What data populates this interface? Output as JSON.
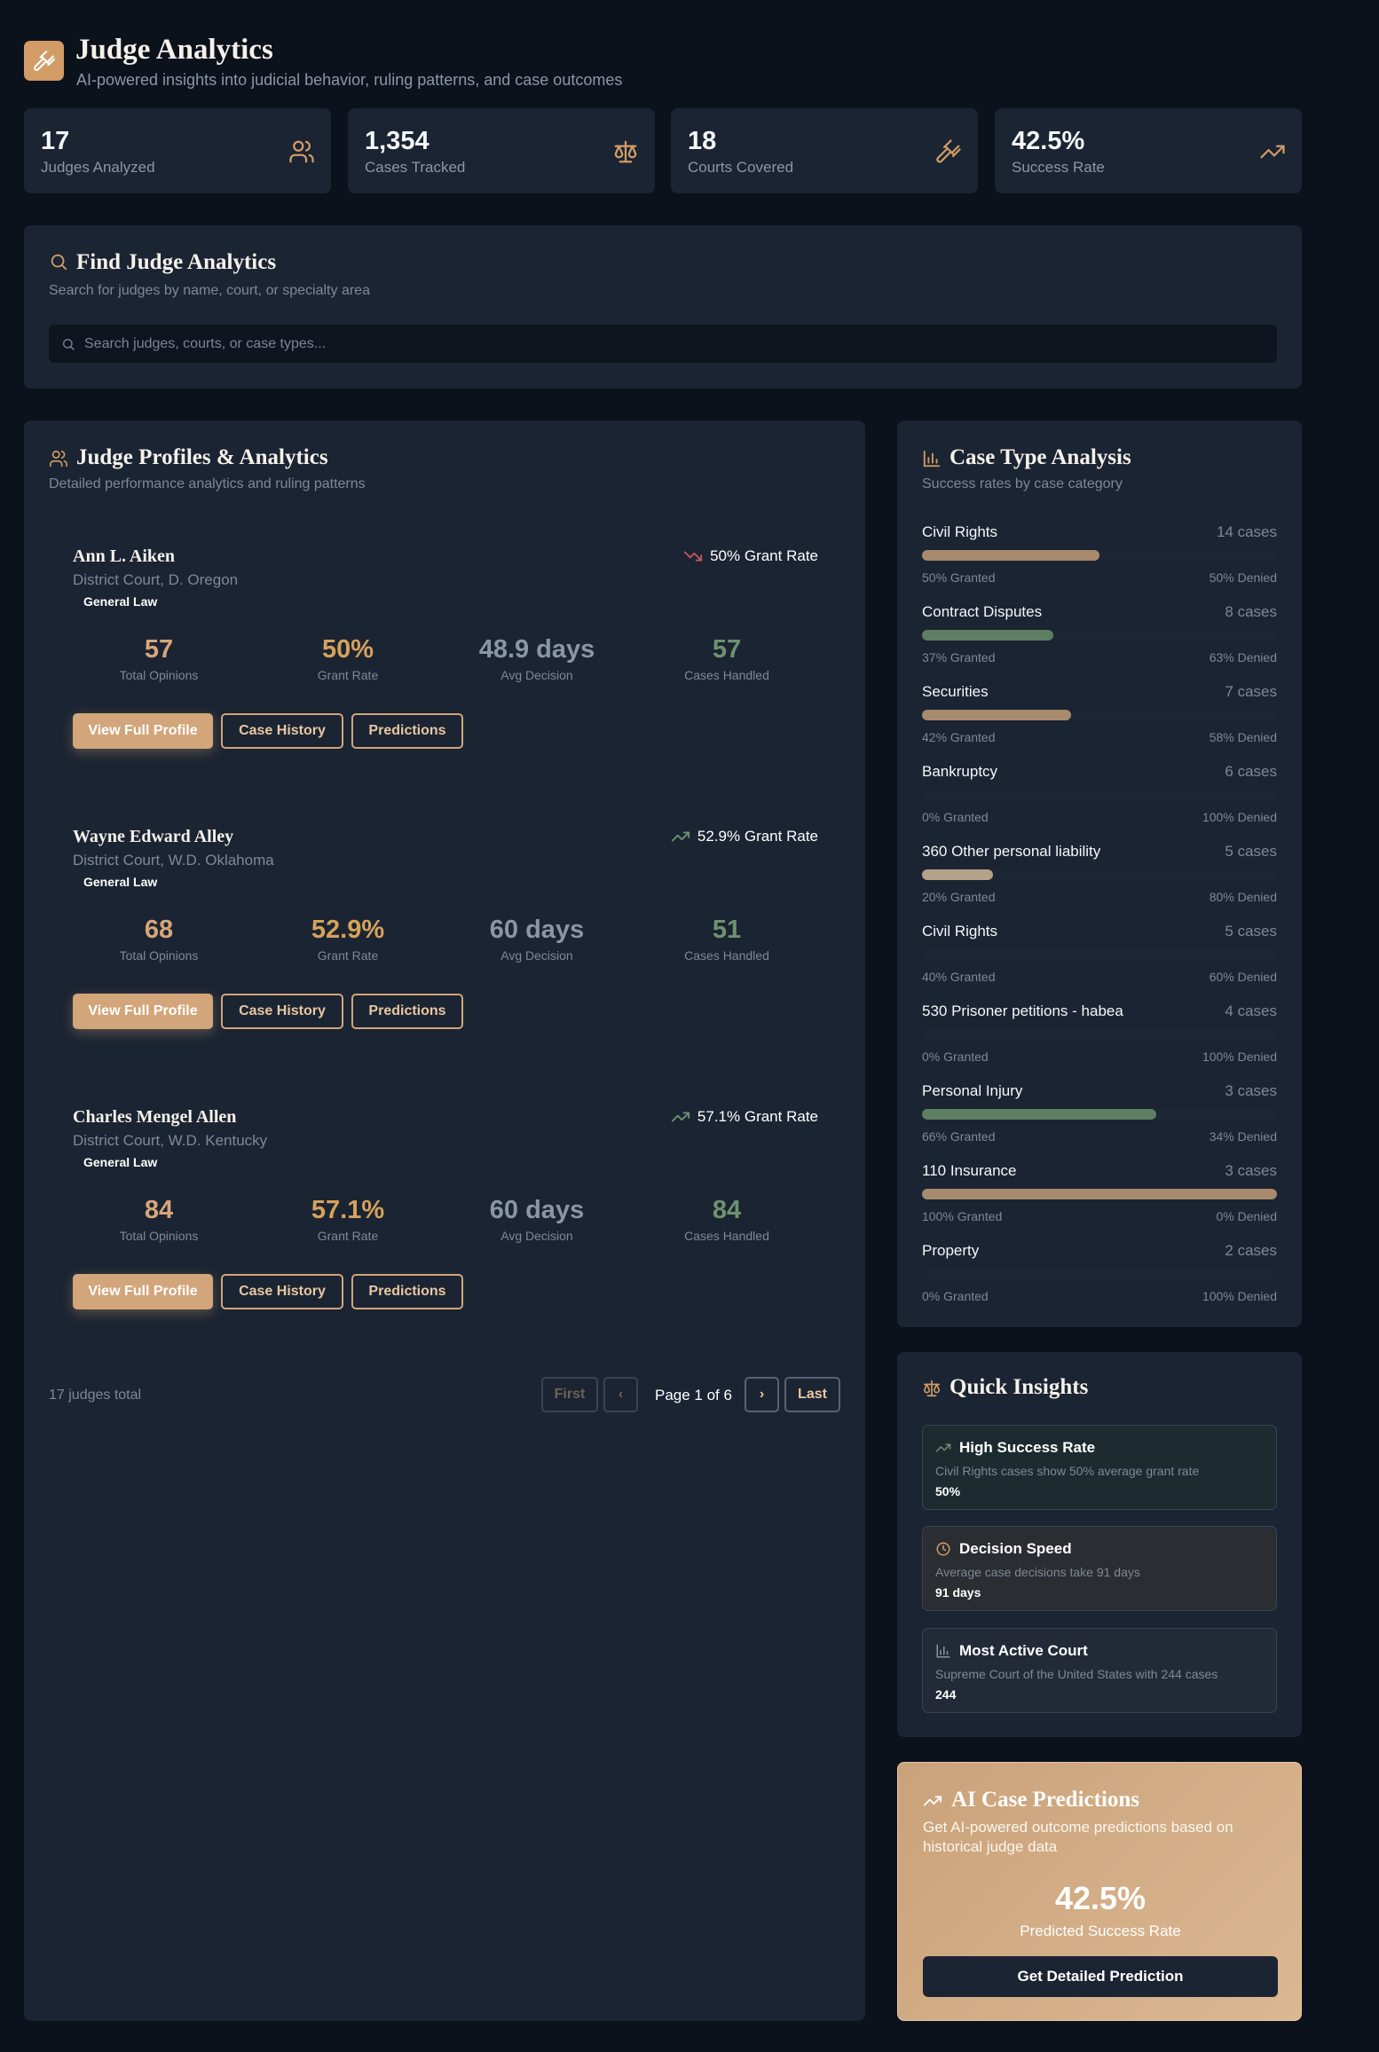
{
  "header": {
    "title": "Judge Analytics",
    "subtitle": "AI-powered insights into judicial behavior, ruling patterns, and case outcomes"
  },
  "stats": [
    {
      "value": "17",
      "label": "Judges Analyzed",
      "icon": "users-icon"
    },
    {
      "value": "1,354",
      "label": "Cases Tracked",
      "icon": "scale-icon"
    },
    {
      "value": "18",
      "label": "Courts Covered",
      "icon": "gavel-icon"
    },
    {
      "value": "42.5%",
      "label": "Success Rate",
      "icon": "trending-up-icon"
    }
  ],
  "search": {
    "title": "Find Judge Analytics",
    "subtitle": "Search for judges by name, court, or specialty area",
    "placeholder": "Search judges, courts, or case types...",
    "value": ""
  },
  "judges_panel": {
    "title": "Judge Profiles & Analytics",
    "subtitle": "Detailed performance analytics and ruling patterns",
    "judges": [
      {
        "name": "Ann L. Aiken",
        "court": "District Court, D. Oregon",
        "tag": "General Law",
        "grant_rate_label": "50% Grant Rate",
        "trend": "down",
        "metrics": [
          {
            "value": "57",
            "label": "Total Opinions"
          },
          {
            "value": "50%",
            "label": "Grant Rate"
          },
          {
            "value": "48.9 days",
            "label": "Avg Decision"
          },
          {
            "value": "57",
            "label": "Cases Handled"
          }
        ]
      },
      {
        "name": "Wayne Edward Alley",
        "court": "District Court, W.D. Oklahoma",
        "tag": "General Law",
        "grant_rate_label": "52.9% Grant Rate",
        "trend": "up",
        "metrics": [
          {
            "value": "68",
            "label": "Total Opinions"
          },
          {
            "value": "52.9%",
            "label": "Grant Rate"
          },
          {
            "value": "60 days",
            "label": "Avg Decision"
          },
          {
            "value": "51",
            "label": "Cases Handled"
          }
        ]
      },
      {
        "name": "Charles Mengel Allen",
        "court": "District Court, W.D. Kentucky",
        "tag": "General Law",
        "grant_rate_label": "57.1% Grant Rate",
        "trend": "up",
        "metrics": [
          {
            "value": "84",
            "label": "Total Opinions"
          },
          {
            "value": "57.1%",
            "label": "Grant Rate"
          },
          {
            "value": "60 days",
            "label": "Avg Decision"
          },
          {
            "value": "84",
            "label": "Cases Handled"
          }
        ]
      }
    ],
    "buttons": {
      "profile": "View Full Profile",
      "history": "Case History",
      "predictions": "Predictions"
    },
    "pagination": {
      "total": "17 judges total",
      "first": "First",
      "prev": "‹",
      "info": "Page 1 of 6",
      "next": "›",
      "last": "Last"
    }
  },
  "case_types": {
    "title": "Case Type Analysis",
    "subtitle": "Success rates by case category",
    "items": [
      {
        "name": "Civil Rights",
        "count": "14 cases",
        "granted": "50% Granted",
        "denied": "50% Denied",
        "pct": 50,
        "color": "#a88a6c"
      },
      {
        "name": "Contract Disputes",
        "count": "8 cases",
        "granted": "37% Granted",
        "denied": "63% Denied",
        "pct": 37,
        "color": "#5e7e62"
      },
      {
        "name": "Securities",
        "count": "7 cases",
        "granted": "42% Granted",
        "denied": "58% Denied",
        "pct": 42,
        "color": "#a88a6c"
      },
      {
        "name": "Bankruptcy",
        "count": "6 cases",
        "granted": "0% Granted",
        "denied": "100% Denied",
        "pct": 0,
        "color": "#a88a6c"
      },
      {
        "name": "360 Other personal liability",
        "count": "5 cases",
        "granted": "20% Granted",
        "denied": "80% Denied",
        "pct": 20,
        "color": "#b6a189"
      },
      {
        "name": "Civil Rights",
        "count": "5 cases",
        "granted": "40% Granted",
        "denied": "60% Denied",
        "pct": 0,
        "color": "#a88a6c"
      },
      {
        "name": "530 Prisoner petitions - habea",
        "count": "4 cases",
        "granted": "0% Granted",
        "denied": "100% Denied",
        "pct": 0,
        "color": "#a88a6c"
      },
      {
        "name": "Personal Injury",
        "count": "3 cases",
        "granted": "66% Granted",
        "denied": "34% Denied",
        "pct": 66,
        "color": "#5e7e62"
      },
      {
        "name": "110 Insurance",
        "count": "3 cases",
        "granted": "100% Granted",
        "denied": "0% Denied",
        "pct": 100,
        "color": "#a88a6c"
      },
      {
        "name": "Property",
        "count": "2 cases",
        "granted": "0% Granted",
        "denied": "100% Denied",
        "pct": 0,
        "color": "#a88a6c"
      }
    ]
  },
  "insights": {
    "title": "Quick Insights",
    "items": [
      {
        "title": "High Success Rate",
        "desc": "Civil Rights cases show 50% average grant rate",
        "value": "50%",
        "icon": "trending-up-icon"
      },
      {
        "title": "Decision Speed",
        "desc": "Average case decisions take 91 days",
        "value": "91 days",
        "icon": "clock-icon"
      },
      {
        "title": "Most Active Court",
        "desc": "Supreme Court of the United States with 244 cases",
        "value": "244",
        "icon": "bar-chart-icon"
      }
    ]
  },
  "prediction": {
    "title": "AI Case Predictions",
    "subtitle": "Get AI-powered outcome predictions based on historical judge data",
    "value": "42.5%",
    "label": "Predicted Success Rate",
    "button": "Get Detailed Prediction"
  },
  "colors": {
    "accent": "#d2a57a",
    "panel": "#1b2432",
    "background": "#0c121c",
    "green": "#6e9270",
    "red_trend": "#c0585a"
  }
}
